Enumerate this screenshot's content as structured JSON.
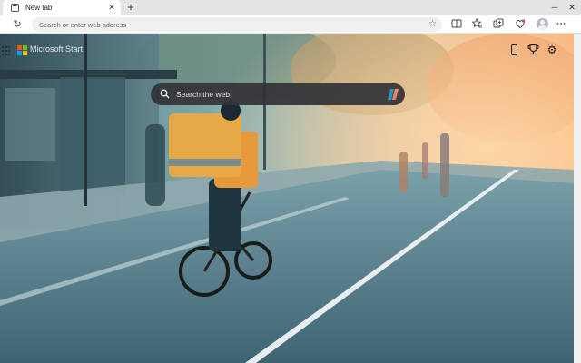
{
  "tab": {
    "title": "New tab",
    "close_glyph": "✕",
    "new_tab_glyph": "+"
  },
  "window": {
    "minimize_glyph": "─",
    "close_glyph": "✕"
  },
  "toolbar": {
    "reload_glyph": "↻",
    "address_placeholder": "Search or enter web address",
    "favorite_glyph": "☆"
  },
  "toolbar_icons": [
    "split-screen-icon",
    "favorites-icon",
    "collections-icon",
    "browser-essentials-icon",
    "profile-icon"
  ],
  "newtab": {
    "brand": "Microsoft Start",
    "search_placeholder": "Search the web",
    "settings_glyph": "⚙"
  },
  "colors": {
    "search_bg": "#323237",
    "tab_strip": "#e4e4e4",
    "toolbar": "#ffffff"
  }
}
